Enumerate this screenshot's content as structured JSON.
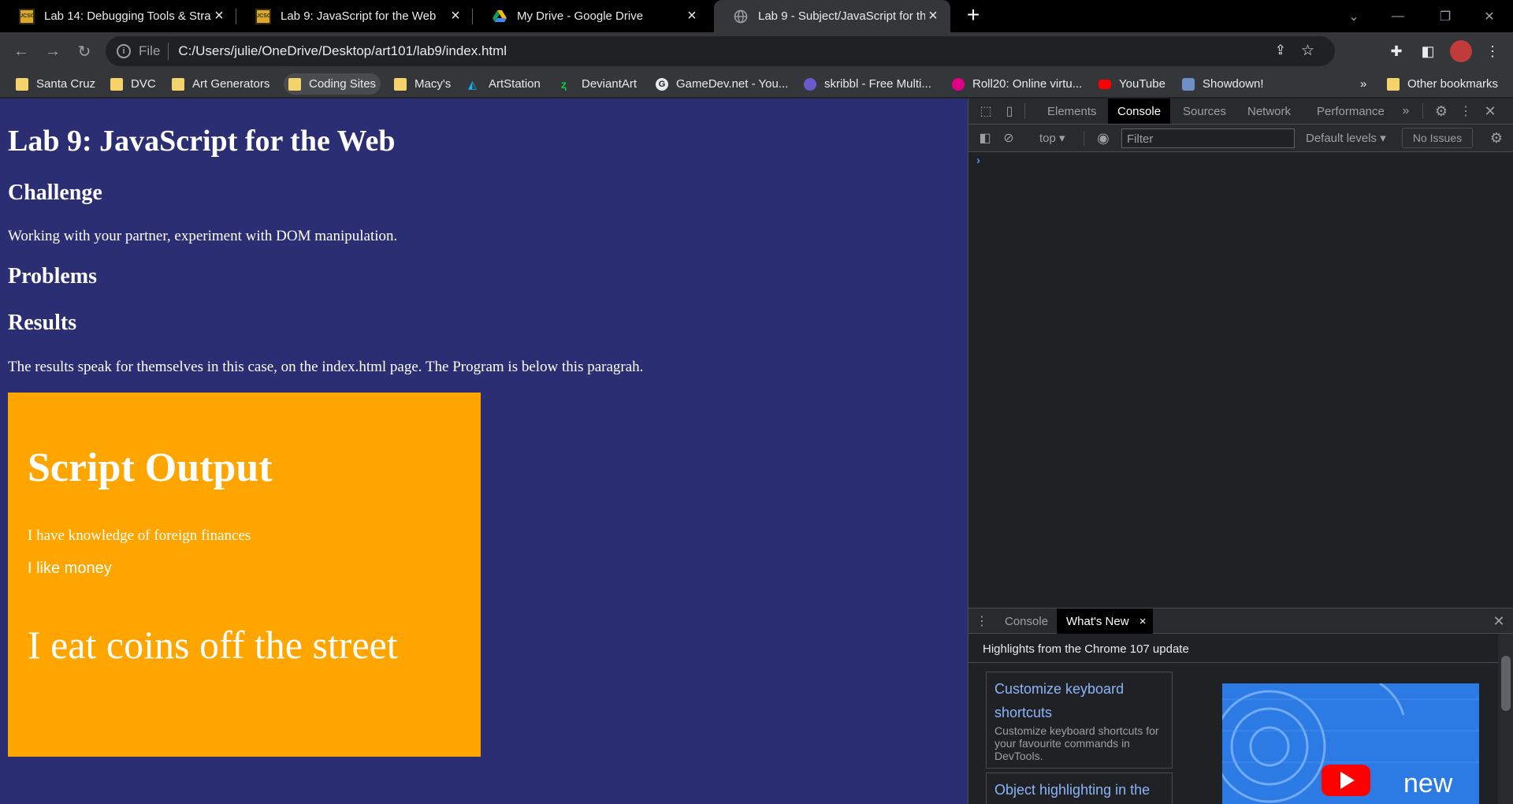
{
  "tabs": [
    {
      "title": "Lab 14: Debugging Tools & Strate",
      "icon": "ucsc-icon"
    },
    {
      "title": "Lab 9: JavaScript for the Web",
      "icon": "ucsc-icon"
    },
    {
      "title": "My Drive - Google Drive",
      "icon": "google-drive-icon"
    },
    {
      "title": "Lab 9 - Subject/JavaScript for the",
      "icon": "globe-icon"
    }
  ],
  "omnibox": {
    "scheme": "File",
    "url": "C:/Users/julie/OneDrive/Desktop/art101/lab9/index.html"
  },
  "bookmarks": [
    "Santa Cruz",
    "DVC",
    "Art Generators",
    "Coding Sites",
    "Macy's",
    "ArtStation",
    "DeviantArt",
    "GameDev.net - You...",
    "skribbl - Free Multi...",
    "Roll20: Online virtu...",
    "YouTube",
    "Showdown!"
  ],
  "other_bookmarks": "Other bookmarks",
  "page": {
    "title": "Lab 9: JavaScript for the Web",
    "challenge_heading": "Challenge",
    "challenge_text": "Working with your partner, experiment with DOM manipulation.",
    "problems_heading": "Problems",
    "results_heading": "Results",
    "results_text": "The results speak for themselves in this case, on the index.html page. The Program is below this paragrah.",
    "output": {
      "heading": "Script Output",
      "line1": "I have knowledge of foreign finances",
      "line2": "I like money",
      "line3": "I eat coins off the street"
    }
  },
  "devtools": {
    "tabs": [
      "Elements",
      "Console",
      "Sources",
      "Network",
      "Performance"
    ],
    "active_tab": "Console",
    "context": "top",
    "filter_placeholder": "Filter",
    "levels": "Default levels",
    "issues": "No Issues",
    "prompt": "›",
    "drawer": {
      "tabs": [
        "Console",
        "What's New"
      ],
      "highlights": "Highlights from the Chrome 107 update",
      "cards": [
        {
          "title": "Customize keyboard shortcuts",
          "desc": "Customize keyboard shortcuts for your favourite commands in DevTools."
        },
        {
          "title": "Object highlighting in the",
          "desc": ""
        }
      ],
      "promo_text": "new"
    }
  },
  "colors": {
    "page_bg": "#2b2e73",
    "output_bg": "#ffa500",
    "accent": "#8ab4f8"
  }
}
